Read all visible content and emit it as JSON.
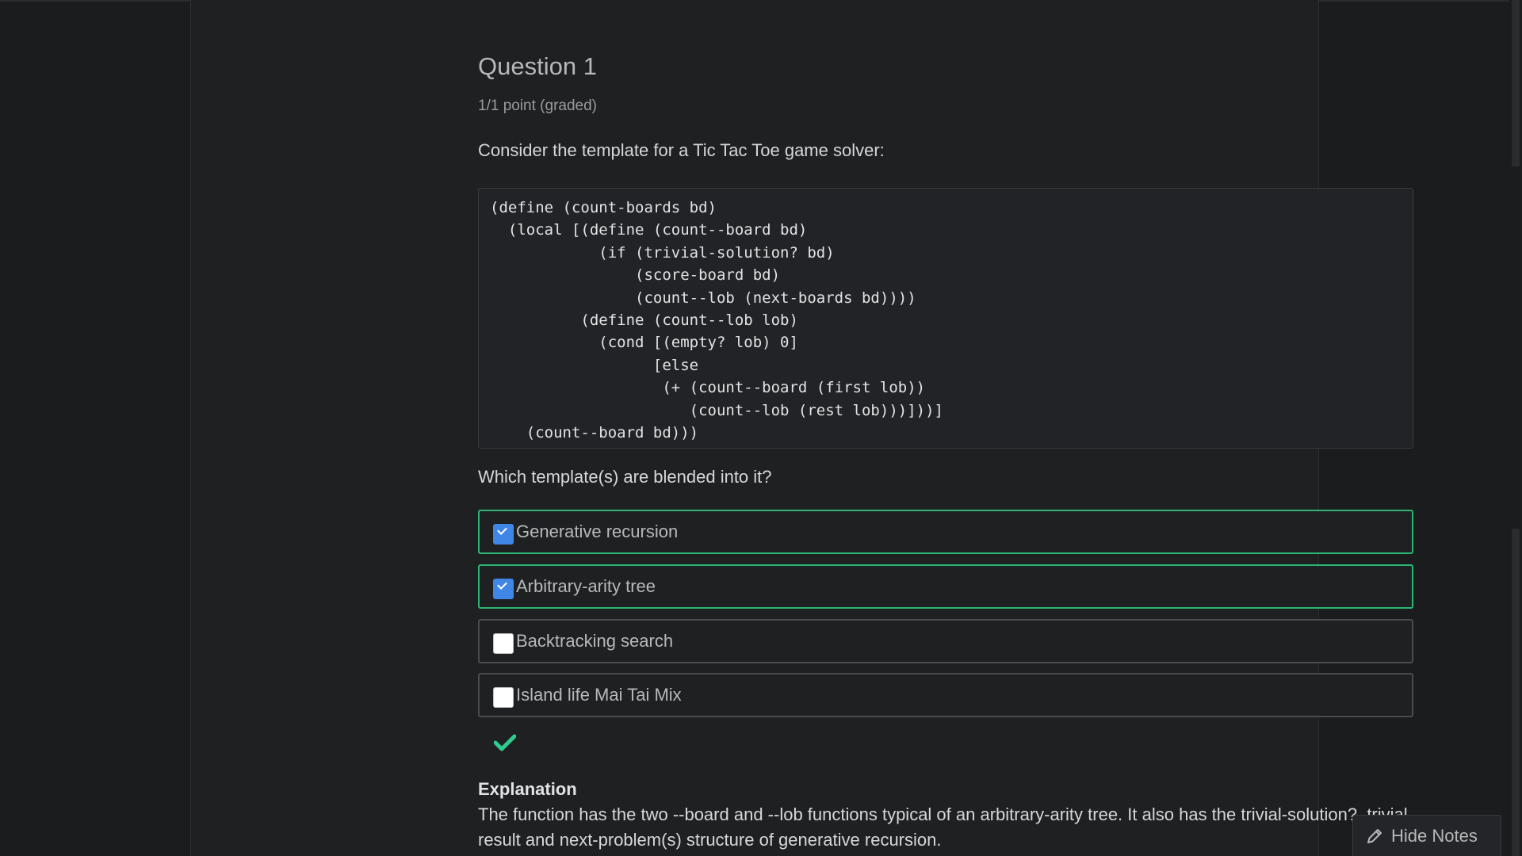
{
  "question": {
    "title": "Question 1",
    "points": "1/1 point (graded)",
    "prompt": "Consider the template for a Tic Tac Toe game solver:",
    "code": "(define (count-boards bd)\n  (local [(define (count--board bd)\n            (if (trivial-solution? bd)\n                (score-board bd)\n                (count--lob (next-boards bd))))\n          (define (count--lob lob)\n            (cond [(empty? lob) 0]\n                  [else\n                   (+ (count--board (first lob))\n                      (count--lob (rest lob)))]))]\n    (count--board bd)))",
    "which": "Which template(s) are blended into it?",
    "choices": [
      {
        "label": "Generative recursion",
        "checked": true,
        "correct": true
      },
      {
        "label": "Arbitrary-arity tree",
        "checked": true,
        "correct": true
      },
      {
        "label": "Backtracking search",
        "checked": false,
        "correct": false
      },
      {
        "label": "Island life Mai Tai Mix",
        "checked": false,
        "correct": false
      }
    ],
    "result_icon": "checkmark-icon",
    "result_color": "#2ecc8f"
  },
  "explanation": {
    "title": "Explanation",
    "text": "The function has the two --board and --lob functions typical of an arbitrary-arity tree. It also has the trivial-solution?, trivial result and next-problem(s) structure of generative recursion."
  },
  "notes_button": {
    "label": "Hide Notes",
    "icon": "pencil-icon"
  },
  "colors": {
    "background": "#1b1c1e",
    "correct_border": "#2bb673",
    "checkbox_checked": "#3f86e6"
  }
}
